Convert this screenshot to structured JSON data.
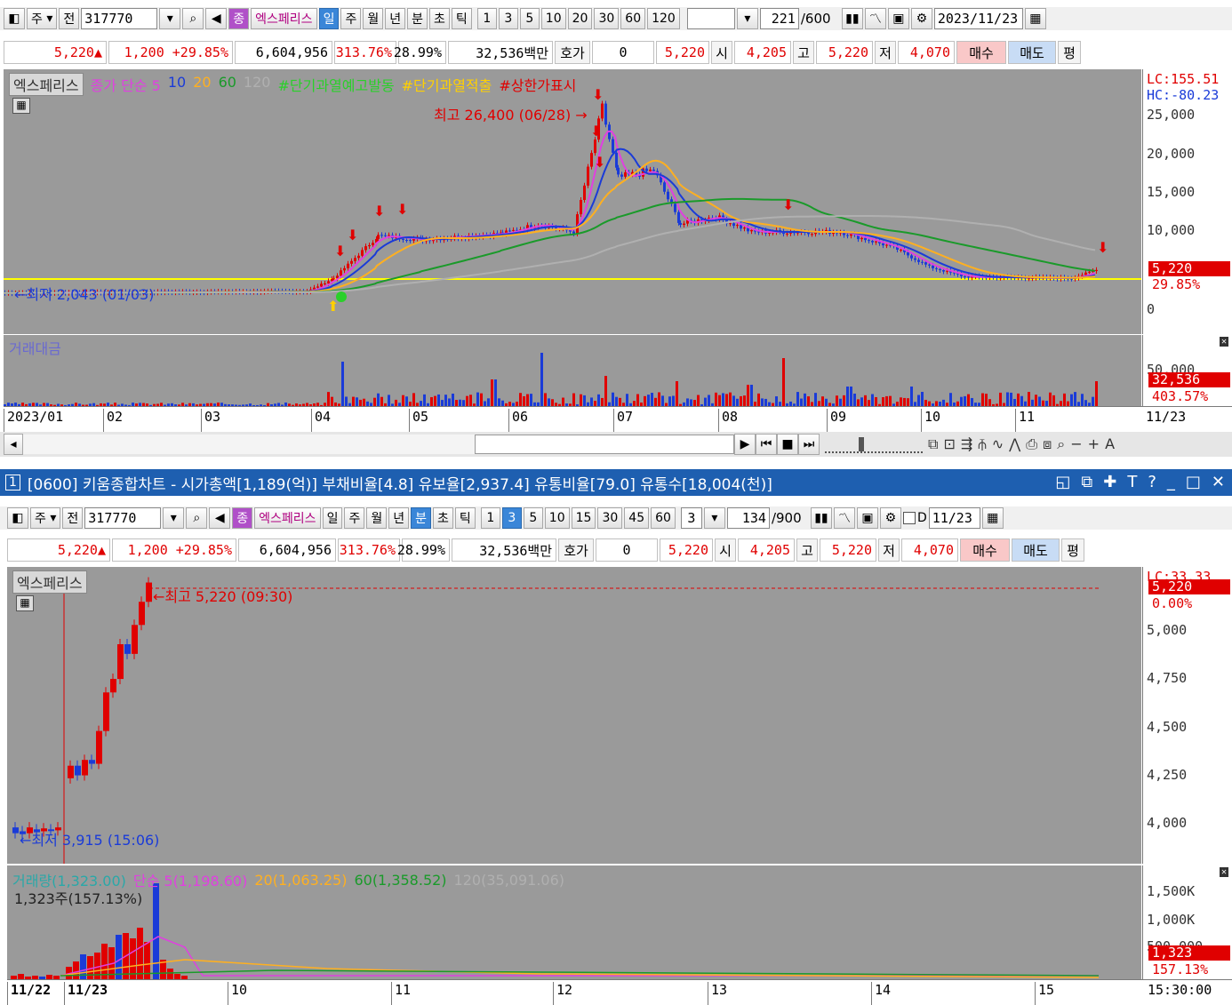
{
  "toolbar": {
    "mode": "주",
    "jeon": "전",
    "code": "317770",
    "badge": "종",
    "name": "엑스페리스",
    "count": "221",
    "count_max": "/600",
    "date": "2023/11/23",
    "periods": [
      "일",
      "주",
      "월",
      "년",
      "분",
      "초",
      "틱"
    ],
    "numbers": [
      "1",
      "3",
      "5",
      "10",
      "20",
      "30",
      "60",
      "120"
    ],
    "selected_period": "일"
  },
  "toolbar2": {
    "mode": "주",
    "jeon": "전",
    "code": "317770",
    "badge": "종",
    "name": "엑스페리스",
    "interval": "3",
    "count": "134",
    "count_max": "/900",
    "d_label": "D",
    "date": "11/23",
    "periods": [
      "일",
      "주",
      "월",
      "년",
      "분",
      "초",
      "틱"
    ],
    "numbers": [
      "1",
      "3",
      "5",
      "10",
      "15",
      "30",
      "45",
      "60"
    ],
    "selected_period": "분",
    "selected_number": "3"
  },
  "price": {
    "price": "5,220",
    "arrow": "▲",
    "change": "1,200",
    "pct": "+29.85%",
    "volume": "6,604,956",
    "vol_ratio": "313.76%",
    "turnover": "28.99%",
    "amount": "32,536백만",
    "hoga_label": "호가",
    "hoga": "0",
    "hoga_price": "5,220",
    "open_label": "시",
    "open": "4,205",
    "high_label": "고",
    "high": "5,220",
    "low_label": "저",
    "low": "4,070",
    "buy": "매수",
    "sell": "매도",
    "avg": "평"
  },
  "chart1": {
    "name": "엑스페리스",
    "legend": [
      {
        "text": "종가 단순 5",
        "color": "#e040e0"
      },
      {
        "text": "10",
        "color": "#1a3bd8"
      },
      {
        "text": "20",
        "color": "#ffb020"
      },
      {
        "text": "60",
        "color": "#1a9a2a"
      },
      {
        "text": "120",
        "color": "#b0b0b0"
      },
      {
        "text": "#단기과열예고발동",
        "color": "#2ad02a"
      },
      {
        "text": "#단기과열적출",
        "color": "#ffd000"
      },
      {
        "text": "#상한가표시",
        "color": "#e00000"
      }
    ],
    "high_ann": "최고 26,400 (06/28)",
    "low_ann": "최저 2,043 (01/03)",
    "lc": "LC:155.51",
    "hc": "HC:-80.23",
    "yticks": [
      "25,000",
      "20,000",
      "15,000",
      "10,000",
      "0"
    ],
    "price_tag": "5,220",
    "pct_tag": "29.85%",
    "vol_title": "거래대금",
    "vol_tick": "50,000",
    "vol_tag": "32,536",
    "vol_pct": "403.57%",
    "xlabels": [
      "2023/01",
      "02",
      "03",
      "04",
      "05",
      "06",
      "07",
      "08",
      "09",
      "10",
      "11",
      "11/23"
    ]
  },
  "chart2": {
    "name": "엑스페리스",
    "high_ann": "최고 5,220 (09:30)",
    "low_ann": "최저 3,915 (15:06)",
    "lc": "LC:33.33",
    "price_tag": "5,220",
    "pct_tag": "0.00%",
    "yticks": [
      "5,000",
      "4,750",
      "4,500",
      "4,250",
      "4,000"
    ],
    "vol_legend": [
      {
        "text": "거래량(1,323.00)",
        "color": "#2aa8a8"
      },
      {
        "text": "단순 5(1,198.60)",
        "color": "#e040e0"
      },
      {
        "text": "20(1,063.25)",
        "color": "#ffb020"
      },
      {
        "text": "60(1,358.52)",
        "color": "#1a9a2a"
      },
      {
        "text": "120(35,091.06)",
        "color": "#b0b0b0"
      }
    ],
    "vol_note": "1,323주(157.13%)",
    "vol_ticks": [
      "1,500K",
      "1,000K",
      "500,000"
    ],
    "vol_tag": "1,323",
    "vol_pct": "157.13%",
    "xlabels": [
      "11/22",
      "11/23",
      "10",
      "11",
      "12",
      "13",
      "14",
      "15",
      "15:30:00"
    ]
  },
  "window": {
    "num": "1",
    "title": "[0600] 키움종합차트 - 시가총액[1,189(억)] 부채비율[4.8] 유보율[2,937.4] 유통비율[79.0] 유통수[18,004(천)]"
  }
}
